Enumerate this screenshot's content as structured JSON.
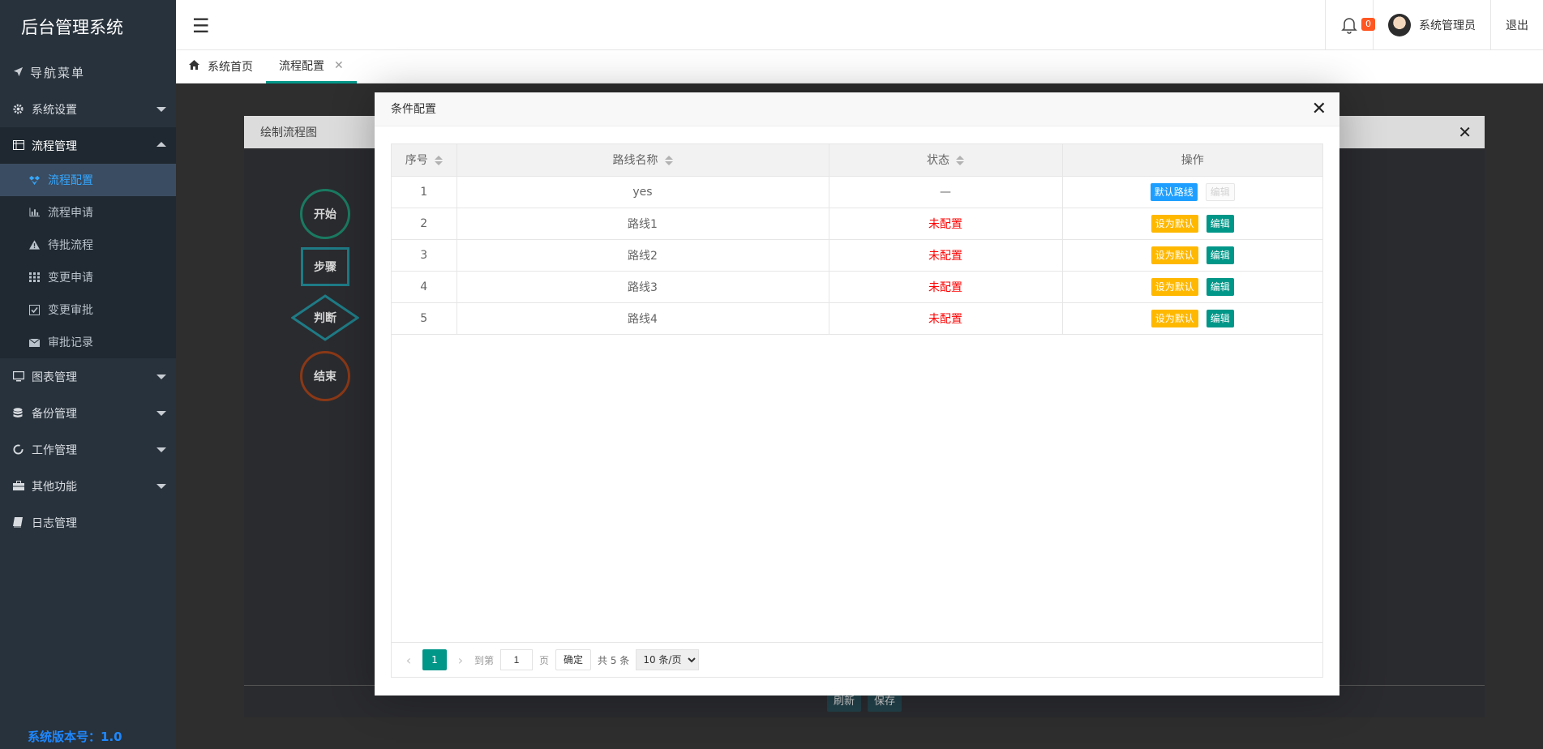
{
  "brand": "后台管理系统",
  "nav": {
    "header": "导航菜单",
    "items": [
      {
        "label": "系统设置"
      },
      {
        "label": "流程管理"
      },
      {
        "label": "图表管理"
      },
      {
        "label": "备份管理"
      },
      {
        "label": "工作管理"
      },
      {
        "label": "其他功能"
      },
      {
        "label": "日志管理"
      }
    ],
    "sub": [
      {
        "label": "流程配置"
      },
      {
        "label": "流程申请"
      },
      {
        "label": "待批流程"
      },
      {
        "label": "变更申请"
      },
      {
        "label": "变更审批"
      },
      {
        "label": "审批记录"
      }
    ],
    "version": "系统版本号：1.0"
  },
  "topbar": {
    "menu_icon": "☰",
    "notif_count": "0",
    "username": "系统管理员",
    "logout": "退出"
  },
  "tabs": [
    {
      "label": "系统首页"
    },
    {
      "label": "流程配置",
      "close": "✕"
    }
  ],
  "flow_dialog": {
    "title": "绘制流程图",
    "close": "✕",
    "shapes": {
      "start": "开始",
      "step": "步骤",
      "judge": "判断",
      "end": "结束"
    },
    "refresh": "刷新",
    "save": "保存"
  },
  "cond_dialog": {
    "title": "条件配置",
    "close": "✕",
    "columns": [
      "序号",
      "路线名称",
      "状态",
      "操作"
    ],
    "rows": [
      {
        "no": "1",
        "name": "yes",
        "status": "—",
        "status_red": false,
        "primary": "默认路线",
        "primary_style": "blue",
        "edit": "编辑",
        "edit_disabled": true
      },
      {
        "no": "2",
        "name": "路线1",
        "status": "未配置",
        "status_red": true,
        "primary": "设为默认",
        "primary_style": "orange",
        "edit": "编辑",
        "edit_disabled": false
      },
      {
        "no": "3",
        "name": "路线2",
        "status": "未配置",
        "status_red": true,
        "primary": "设为默认",
        "primary_style": "orange",
        "edit": "编辑",
        "edit_disabled": false
      },
      {
        "no": "4",
        "name": "路线3",
        "status": "未配置",
        "status_red": true,
        "primary": "设为默认",
        "primary_style": "orange",
        "edit": "编辑",
        "edit_disabled": false
      },
      {
        "no": "5",
        "name": "路线4",
        "status": "未配置",
        "status_red": true,
        "primary": "设为默认",
        "primary_style": "orange",
        "edit": "编辑",
        "edit_disabled": false
      }
    ],
    "pager": {
      "prev": "‹",
      "current": "1",
      "next": "›",
      "goto_label": "到第",
      "goto_value": "1",
      "page_label": "页",
      "confirm": "确定",
      "total": "共 5 条",
      "page_size": "10 条/页"
    }
  }
}
